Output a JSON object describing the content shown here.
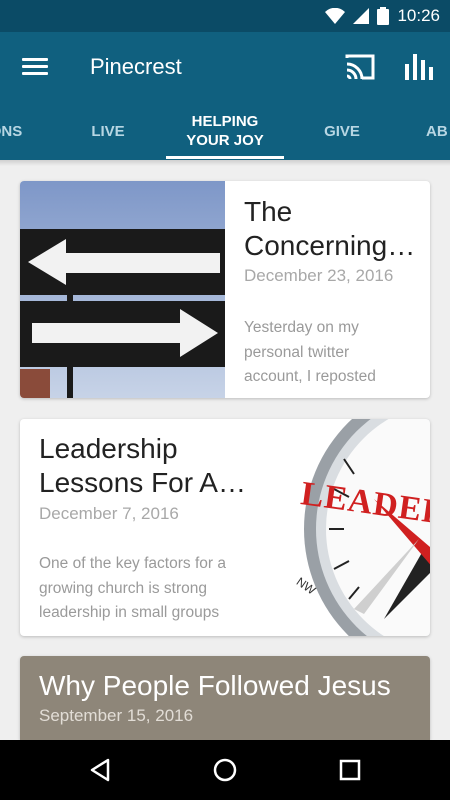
{
  "status_bar": {
    "time": "10:26"
  },
  "app_bar": {
    "title": "Pinecrest"
  },
  "tabs": [
    {
      "label": "ONS"
    },
    {
      "label": "LIVE"
    },
    {
      "label": "HELPING\nYOUR JOY"
    },
    {
      "label": "GIVE"
    },
    {
      "label": "AB"
    }
  ],
  "posts": [
    {
      "title": "The Concerning…",
      "date": "December 23, 2016",
      "excerpt": "Yesterday on my personal twitter account, I reposted"
    },
    {
      "title": "Leadership Lessons For A…",
      "date": "December 7, 2016",
      "excerpt": "One of the key factors for a growing church is strong leadership in small groups"
    },
    {
      "title": "Why People Followed Jesus",
      "date": "September 15, 2016"
    }
  ],
  "images": {
    "compass_letters": "LEADERSHIP",
    "compass_dir": "NW"
  },
  "icons": [
    "wifi-icon",
    "signal-icon",
    "battery-icon",
    "menu-icon",
    "cast-icon",
    "stats-icon",
    "back-icon",
    "home-icon",
    "recents-icon"
  ],
  "colors": {
    "app_bar": "#10607f",
    "status_bar": "#0b4b66",
    "card3_bg": "#8e8679"
  }
}
